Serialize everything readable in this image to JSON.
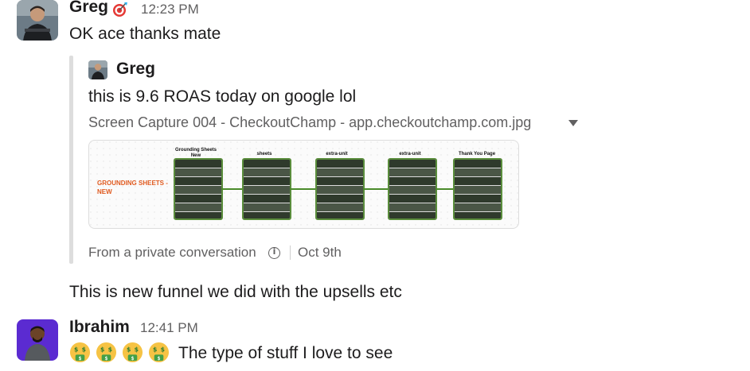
{
  "messages": [
    {
      "author": "Greg",
      "status_emoji": "dart-status-icon",
      "time": "12:23 PM",
      "text": "OK ace thanks mate",
      "quote": {
        "author": "Greg",
        "text": "this is 9.6 ROAS today on google lol",
        "file_name": "Screen Capture 004 - CheckoutChamp - app.checkoutchamp.com.jpg",
        "source": "From a private conversation",
        "date": "Oct 9th",
        "preview": {
          "funnel_label": "GROUNDING SHEETS - NEW",
          "nodes": [
            {
              "title": "Grounding Sheets New"
            },
            {
              "title": "sheets"
            },
            {
              "title": "extra-unit"
            },
            {
              "title": "extra-unit"
            },
            {
              "title": "Thank You Page"
            }
          ]
        }
      }
    },
    {
      "author": "Greg",
      "text": "This is new funnel we did with the upsells etc"
    },
    {
      "author": "Ibrahim",
      "time": "12:41 PM",
      "emojis": [
        "money-mouth-face-icon",
        "money-mouth-face-icon",
        "money-mouth-face-icon",
        "money-mouth-face-icon"
      ],
      "text": "The type of stuff I love to see"
    }
  ],
  "colors": {
    "accent_green": "#5a8d3c",
    "orange_label": "#e05a1f",
    "muted_text": "#616061"
  }
}
